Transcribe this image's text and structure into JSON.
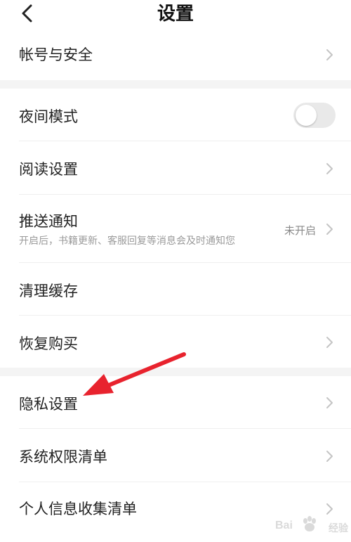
{
  "header": {
    "title": "设置",
    "back_icon": "chevron-left-icon"
  },
  "rows": {
    "account": {
      "label": "帐号与安全"
    },
    "night_mode": {
      "label": "夜间模式",
      "toggle_on": false
    },
    "reading": {
      "label": "阅读设置"
    },
    "push": {
      "label": "推送通知",
      "subtitle": "开启后，书籍更新、客服回复等消息会及时通知您",
      "value": "未开启"
    },
    "cache": {
      "label": "清理缓存"
    },
    "restore": {
      "label": "恢复购买"
    },
    "privacy": {
      "label": "隐私设置"
    },
    "permissions": {
      "label": "系统权限清单"
    },
    "personal_info": {
      "label": "个人信息收集清单"
    }
  },
  "annotation": {
    "arrow_color": "#e8232e"
  },
  "watermark": {
    "text_left": "Bai",
    "text_right": "经验"
  },
  "colors": {
    "background": "#ffffff",
    "section_gap": "#f4f4f4",
    "text_primary": "#222222",
    "text_secondary": "#9a9a9a",
    "chevron": "#c4c4c4",
    "toggle_off": "#e9e9e9"
  }
}
